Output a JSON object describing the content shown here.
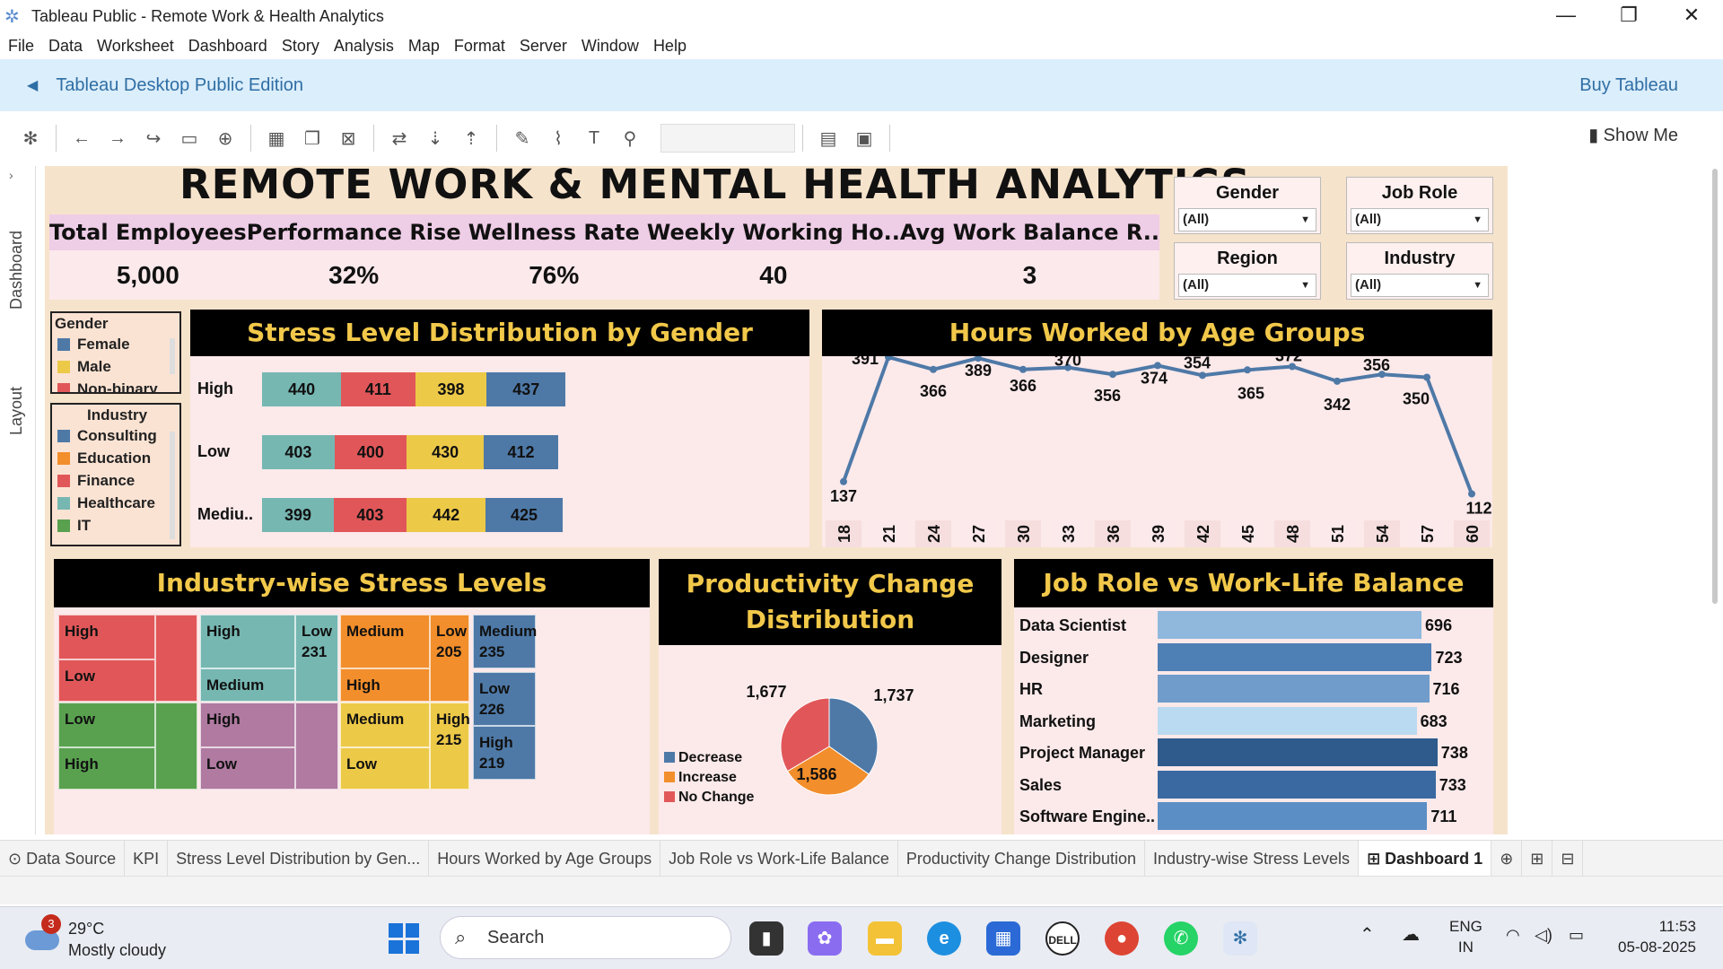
{
  "window": {
    "title": "Tableau Public - Remote Work & Health Analytics",
    "minimize": "—",
    "maximize": "❐",
    "close": "✕"
  },
  "menu": [
    "File",
    "Data",
    "Worksheet",
    "Dashboard",
    "Story",
    "Analysis",
    "Map",
    "Format",
    "Server",
    "Window",
    "Help"
  ],
  "banner": {
    "edition": "Tableau Desktop Public Edition",
    "buy": "Buy Tableau"
  },
  "toolbar": {
    "show_me": "Show Me"
  },
  "side_tabs": {
    "dashboard": "Dashboard",
    "layout": "Layout"
  },
  "dashboard": {
    "title": "REMOTE WORK & MENTAL HEALTH ANALYTICS",
    "kpis": [
      {
        "label": "Total Employees",
        "value": "5,000"
      },
      {
        "label": "Performance Rise",
        "value": "32%"
      },
      {
        "label": "Wellness Rate",
        "value": "76%"
      },
      {
        "label": "Weekly Working Ho..",
        "value": "40"
      },
      {
        "label": "Avg Work Balance R..",
        "value": "3"
      }
    ],
    "filters": [
      {
        "label": "Gender",
        "value": "(All)"
      },
      {
        "label": "Job Role",
        "value": "(All)"
      },
      {
        "label": "Region",
        "value": "(All)"
      },
      {
        "label": "Industry",
        "value": "(All)"
      }
    ],
    "gender_legend": {
      "title": "Gender",
      "items": [
        {
          "name": "Female",
          "color": "#4e79a7"
        },
        {
          "name": "Male",
          "color": "#edc948"
        },
        {
          "name": "Non-binary",
          "color": "#e15759"
        }
      ]
    },
    "industry_legend": {
      "title": "Industry",
      "items": [
        {
          "name": "Consulting",
          "color": "#4e79a7"
        },
        {
          "name": "Education",
          "color": "#f28e2b"
        },
        {
          "name": "Finance",
          "color": "#e15759"
        },
        {
          "name": "Healthcare",
          "color": "#76b7b2"
        },
        {
          "name": "IT",
          "color": "#59a14f"
        }
      ]
    },
    "stress_title": "Stress Level Distribution by Gender",
    "hours_title": "Hours Worked by Age Groups",
    "industry_title": "Industry-wise Stress Levels",
    "prod_title": "Productivity Change Distribution",
    "jobrole_title": "Job Role vs Work-Life Balance",
    "treemap": [
      {
        "label": "High",
        "color": "#e15759"
      },
      {
        "label": "Low",
        "color": "#e15759"
      },
      {
        "label": "",
        "color": "#e15759"
      },
      {
        "label": "High",
        "color": "#76b7b2"
      },
      {
        "label": "Medium",
        "color": "#76b7b2"
      },
      {
        "label": "Low\n231",
        "color": "#76b7b2"
      },
      {
        "label": "Medium",
        "color": "#f28e2b"
      },
      {
        "label": "High",
        "color": "#f28e2b"
      },
      {
        "label": "Low\n205",
        "color": "#f28e2b"
      },
      {
        "label": "Medium\n235",
        "color": "#4e79a7"
      },
      {
        "label": "Low\n226",
        "color": "#4e79a7"
      },
      {
        "label": "High\n219",
        "color": "#4e79a7"
      },
      {
        "label": "Low",
        "color": "#59a14f"
      },
      {
        "label": "High",
        "color": "#59a14f"
      },
      {
        "label": "",
        "color": "#59a14f"
      },
      {
        "label": "High",
        "color": "#b07aa1"
      },
      {
        "label": "Low",
        "color": "#b07aa1"
      },
      {
        "label": "",
        "color": "#b07aa1"
      },
      {
        "label": "Medium",
        "color": "#edc948"
      },
      {
        "label": "Low",
        "color": "#edc948"
      },
      {
        "label": "High\n215",
        "color": "#edc948"
      }
    ]
  },
  "chart_data": [
    {
      "type": "bar",
      "orientation": "horizontal",
      "stacked": true,
      "title": "Stress Level Distribution by Gender",
      "categories": [
        "High",
        "Low",
        "Mediu.."
      ],
      "series": [
        {
          "color": "#76b7b2",
          "values": [
            440,
            403,
            399
          ]
        },
        {
          "color": "#e15759",
          "values": [
            411,
            400,
            403
          ]
        },
        {
          "color": "#edc948",
          "values": [
            398,
            430,
            442
          ]
        },
        {
          "color": "#4e79a7",
          "values": [
            437,
            412,
            425
          ]
        }
      ]
    },
    {
      "type": "line",
      "title": "Hours Worked by Age Groups",
      "x": [
        18,
        21,
        24,
        27,
        30,
        33,
        36,
        39,
        42,
        45,
        48,
        51,
        54,
        57,
        60
      ],
      "y": [
        137,
        391,
        366,
        389,
        366,
        370,
        356,
        374,
        354,
        365,
        372,
        342,
        356,
        350,
        112
      ],
      "color": "#4e79a7"
    },
    {
      "type": "pie",
      "title": "Productivity Change Distribution",
      "labels": [
        "Decrease",
        "Increase",
        "No Change"
      ],
      "values": [
        1737,
        1586,
        1677
      ],
      "colors": [
        "#4e79a7",
        "#f28e2b",
        "#e15759"
      ],
      "display": [
        "1,737",
        "1,586",
        "1,677"
      ]
    },
    {
      "type": "bar",
      "orientation": "horizontal",
      "title": "Job Role vs Work-Life Balance",
      "categories": [
        "Data Scientist",
        "Designer",
        "HR",
        "Marketing",
        "Project Manager",
        "Sales",
        "Software Engine.."
      ],
      "values": [
        696,
        723,
        716,
        683,
        738,
        733,
        711
      ],
      "colors": [
        "#8fb8dc",
        "#4e7fb5",
        "#6f9cca",
        "#b9daf0",
        "#2e5b8c",
        "#3a69a1",
        "#5b8ec4"
      ]
    }
  ],
  "bottom_tabs": [
    "Data Source",
    "KPI",
    "Stress Level Distribution by Gen...",
    "Hours Worked by Age Groups",
    "Job Role vs Work-Life Balance",
    "Productivity Change Distribution",
    "Industry-wise Stress Levels",
    "Dashboard 1"
  ],
  "taskbar": {
    "temp": "29°C",
    "weather": "Mostly cloudy",
    "badge": "3",
    "search": "Search",
    "lang1": "ENG",
    "lang2": "IN",
    "time": "11:53",
    "date": "05-08-2025"
  }
}
